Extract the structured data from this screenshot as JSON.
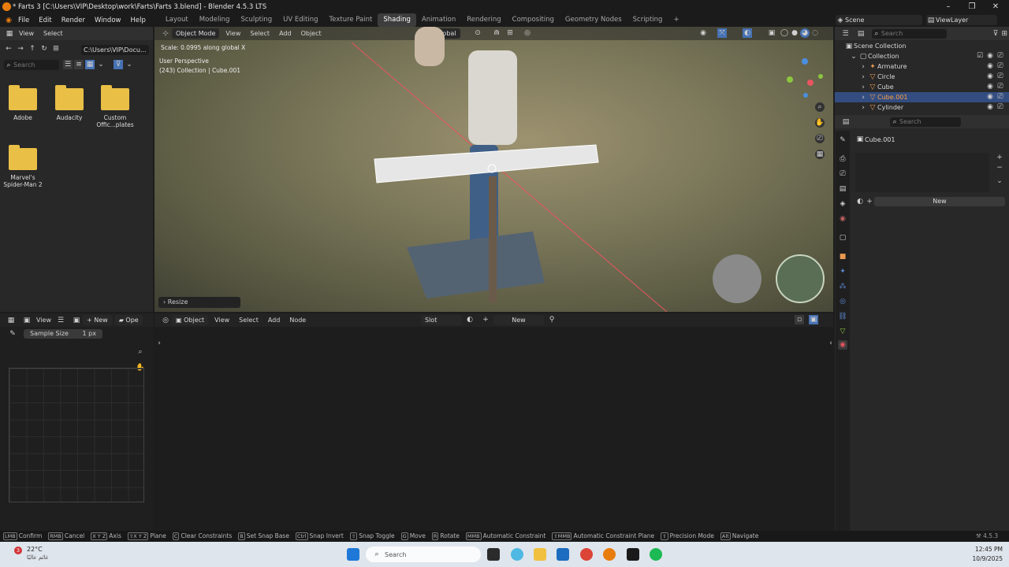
{
  "title_bar": {
    "title": "* Farts 3 [C:\\Users\\VIP\\Desktop\\work\\Farts\\Farts 3.blend] - Blender 4.5.3 LTS",
    "minimize": "–",
    "maximize": "❐",
    "close": "✕"
  },
  "menu": {
    "items": [
      "File",
      "Edit",
      "Render",
      "Window",
      "Help"
    ],
    "workspaces": [
      "Layout",
      "Modeling",
      "Sculpting",
      "UV Editing",
      "Texture Paint",
      "Shading",
      "Animation",
      "Rendering",
      "Compositing",
      "Geometry Nodes",
      "Scripting"
    ],
    "active_workspace": "Shading",
    "add_tab": "+",
    "scene": "Scene",
    "view_layer": "ViewLayer"
  },
  "file_browser": {
    "menu": [
      "View",
      "Select"
    ],
    "path": "C:\\Users\\VIP\\Docu...",
    "search_placeholder": "Search",
    "folders": [
      {
        "name": "Adobe"
      },
      {
        "name": "Audacity"
      },
      {
        "name": "Custom Offic...plates"
      },
      {
        "name": "Marvel's Spider-Man 2"
      }
    ]
  },
  "viewport": {
    "mode": "Object Mode",
    "menu": [
      "View",
      "Select",
      "Add",
      "Object"
    ],
    "orientation": "Global",
    "operator_text": "Scale: 0.0995 along global X",
    "perspective": "User Perspective",
    "collection_info": "(243) Collection | Cube.001",
    "last_op_panel": "Resize"
  },
  "outliner": {
    "search_placeholder": "Search",
    "items": [
      {
        "label": "Scene Collection"
      },
      {
        "label": "Collection"
      },
      {
        "label": "Armature"
      },
      {
        "label": "Circle"
      },
      {
        "label": "Cube"
      },
      {
        "label": "Cube.001",
        "selected": true
      },
      {
        "label": "Cylinder"
      }
    ]
  },
  "properties": {
    "search_placeholder": "Search",
    "object_name": "Cube.001",
    "new_label": "New"
  },
  "image_editor": {
    "menu": [
      "View"
    ],
    "new_label": "New",
    "open_label": "Ope",
    "sample_size_label": "Sample Size",
    "sample_size_value": "1 px"
  },
  "node_editor": {
    "object_dropdown": "Object",
    "menu": [
      "View",
      "Select",
      "Add",
      "Node"
    ],
    "slot": "Slot",
    "new_label": "New"
  },
  "status_bar": {
    "items": [
      {
        "key": "LMB",
        "label": "Confirm"
      },
      {
        "key": "RMB",
        "label": "Cancel"
      },
      {
        "key": "X Y Z",
        "label": "Axis"
      },
      {
        "key": "⇧X Y Z",
        "label": "Plane"
      },
      {
        "key": "C",
        "label": "Clear Constraints"
      },
      {
        "key": "B",
        "label": "Set Snap Base"
      },
      {
        "key": "Ctrl",
        "label": "Snap Invert"
      },
      {
        "key": "⇧",
        "label": "Snap Toggle"
      },
      {
        "key": "G",
        "label": "Move"
      },
      {
        "key": "R",
        "label": "Rotate"
      },
      {
        "key": "MMB",
        "label": "Automatic Constraint"
      },
      {
        "key": "⇧MMB",
        "label": "Automatic Constraint Plane"
      },
      {
        "key": "⇧",
        "label": "Precision Mode"
      },
      {
        "key": "Alt",
        "label": "Navigate"
      }
    ],
    "version": "4.5.3"
  },
  "taskbar": {
    "weather_temp": "22°C",
    "weather_desc": "غائم عالبًا",
    "weather_badge": "3",
    "search_placeholder": "Search",
    "time": "12:45 PM",
    "date": "10/9/2025"
  },
  "colors": {
    "selection": "#334d80",
    "folder": "#e9bf46",
    "accent_blue": "#4772b3",
    "x_axis": "#e8555f",
    "y_axis": "#8cc63f",
    "z_axis": "#4a8fe0"
  }
}
